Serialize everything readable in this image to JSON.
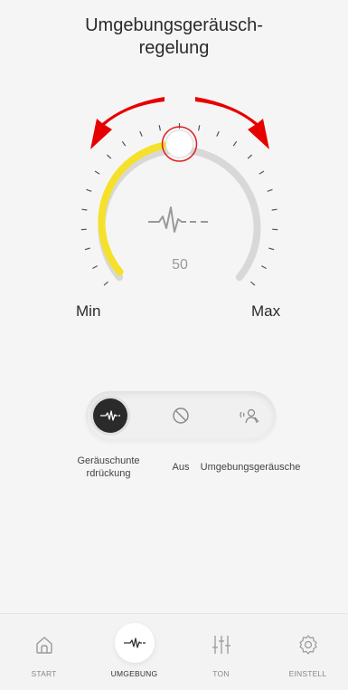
{
  "header": {
    "title_line1": "Umgebungsgeräusch-",
    "title_line2": "regelung"
  },
  "dial": {
    "value": 50,
    "value_text": "50",
    "min_label": "Min",
    "max_label": "Max",
    "center_icon": "noise-wave-icon",
    "colors": {
      "active_arc": "#f5e12c",
      "inactive_arc": "#d8d8d8",
      "arrows": "#e60000",
      "handle_ring": "#e02020"
    }
  },
  "modes": {
    "selected": "noise_cancel",
    "items": [
      {
        "id": "noise_cancel",
        "label_line1": "Geräuschunte",
        "label_line2": "rdrückung",
        "icon": "noise-cancel-icon"
      },
      {
        "id": "off",
        "label_line1": "Aus",
        "label_line2": "",
        "icon": "off-icon"
      },
      {
        "id": "ambient",
        "label_line1": "Umgebungsgeräusche",
        "label_line2": "",
        "icon": "ambient-sound-icon"
      }
    ]
  },
  "nav": {
    "items": [
      {
        "label": "START",
        "icon": "home-icon",
        "active": false
      },
      {
        "label": "UMGEBUNG",
        "icon": "wave-icon",
        "active": true
      },
      {
        "label": "TON",
        "icon": "equalizer-icon",
        "active": false
      },
      {
        "label": "EINSTELL",
        "icon": "settings-icon",
        "active": false
      }
    ]
  }
}
